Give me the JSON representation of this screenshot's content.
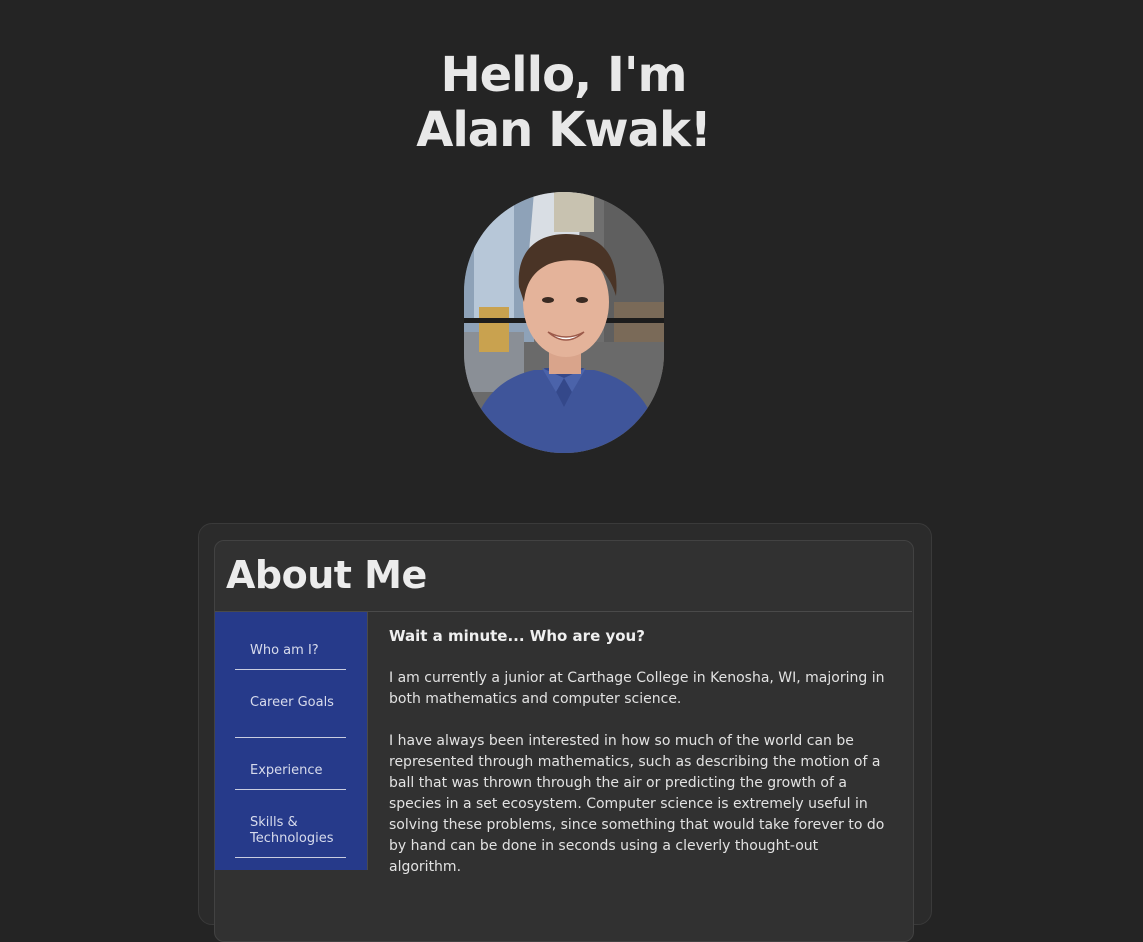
{
  "hero": {
    "line1": "Hello, I'm",
    "line2": "Alan Kwak!"
  },
  "about": {
    "title": "About Me",
    "nav": [
      {
        "label": "Who am I?"
      },
      {
        "label": "Career Goals"
      },
      {
        "label": "Experience"
      },
      {
        "label": "Skills & Technologies"
      }
    ],
    "heading": "Wait a minute... Who are you?",
    "paragraphs": [
      "I am currently a junior at Carthage College in Kenosha, WI, majoring in both mathematics and computer science.",
      "I have always been interested in how so much of the world can be represented through mathematics, such as describing the motion of a ball that was thrown through the air or predicting the growth of a species in a set ecosystem. Computer science is extremely useful in solving these problems, since something that would take forever to do by hand can be done in seconds using a cleverly thought-out algorithm."
    ]
  },
  "colors": {
    "background": "#242424",
    "sidebar": "#263a8a",
    "card": "#313131"
  }
}
